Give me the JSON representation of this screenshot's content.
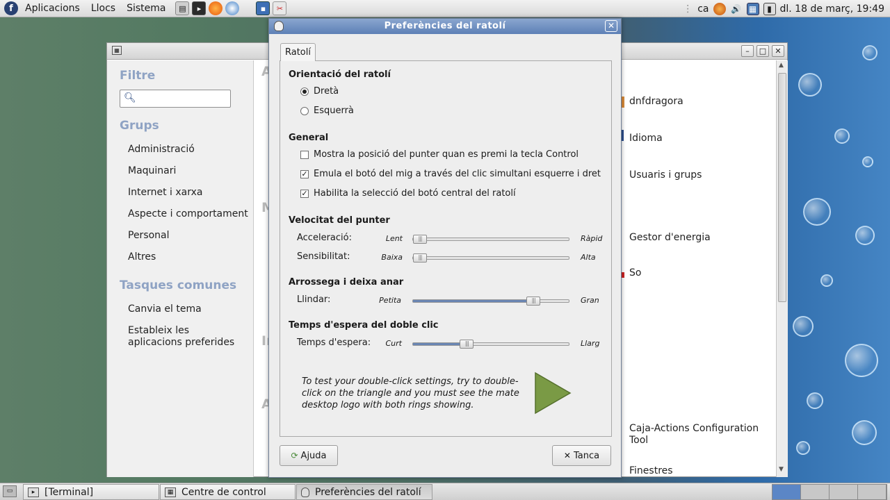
{
  "top_panel": {
    "menus": [
      "Aplicacions",
      "Llocs",
      "Sistema"
    ],
    "keyboard_layout": "ca",
    "clock": "dl. 18 de març, 19:49"
  },
  "taskbar": {
    "tasks": [
      "[Terminal]",
      "Centre de control",
      "Preferències del ratolí"
    ]
  },
  "control_center": {
    "sidebar": {
      "filter_heading": "Filtre",
      "groups_heading": "Grups",
      "groups": [
        "Administració",
        "Maquinari",
        "Internet i xarxa",
        "Aspecte i comportament",
        "Personal",
        "Altres"
      ],
      "tasks_heading": "Tasques comunes",
      "tasks": [
        "Canvia el tema",
        "Estableix les aplicacions preferides"
      ]
    },
    "items": [
      "dnfdragora",
      "Idioma",
      "Usuaris i grups",
      "Gestor d'energia",
      "So",
      "Caja-Actions Configuration Tool",
      "Finestres"
    ],
    "section_initials": [
      "A",
      "M",
      "In",
      "A"
    ]
  },
  "dialog": {
    "title": "Preferències del ratolí",
    "tab": "Ratolí",
    "orientation": {
      "title": "Orientació del ratolí",
      "right": "Dretà",
      "left": "Esquerrà",
      "selected": "right"
    },
    "general": {
      "title": "General",
      "options": [
        {
          "label": "Mostra la posició del punter quan es premi la tecla Control",
          "checked": false
        },
        {
          "label": "Emula el botó del mig a través del clic simultani esquerre i dret",
          "checked": true
        },
        {
          "label": "Habilita la selecció del botó central del ratolí",
          "checked": true
        }
      ]
    },
    "speed": {
      "title": "Velocitat del punter",
      "acceleration": {
        "label": "Acceleració:",
        "min": "Lent",
        "max": "Ràpid",
        "value": 0.0
      },
      "sensitivity": {
        "label": "Sensibilitat:",
        "min": "Baixa",
        "max": "Alta",
        "value": 0.0
      }
    },
    "drag": {
      "title": "Arrossega i deixa anar",
      "threshold": {
        "label": "Llindar:",
        "min": "Petita",
        "max": "Gran",
        "value": 0.8
      }
    },
    "double_click": {
      "title": "Temps d'espera del doble clic",
      "timeout": {
        "label": "Temps d'espera:",
        "min": "Curt",
        "max": "Llarg",
        "value": 0.33
      },
      "test_text": "To test your double-click settings, try to double-click on the triangle and you must see the mate desktop logo with both rings showing."
    },
    "buttons": {
      "help": "Ajuda",
      "close": "Tanca"
    }
  },
  "colors": {
    "dialog_titlebar": "#6f8fc2",
    "heading_blue": "#8fa3c4",
    "triangle": "#7a9a45"
  }
}
